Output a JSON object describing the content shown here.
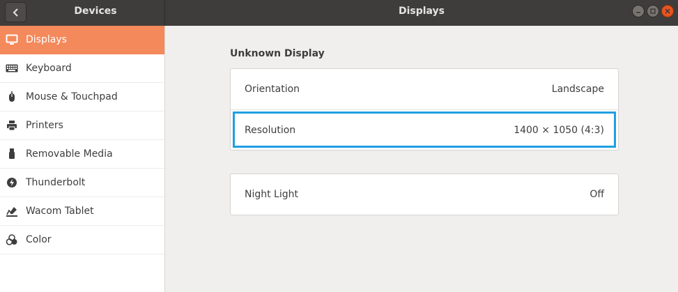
{
  "headerbar": {
    "left_title": "Devices",
    "title": "Displays"
  },
  "sidebar": {
    "items": [
      {
        "label": "Displays",
        "icon": "display-icon",
        "active": true
      },
      {
        "label": "Keyboard",
        "icon": "keyboard-icon"
      },
      {
        "label": "Mouse & Touchpad",
        "icon": "mouse-icon"
      },
      {
        "label": "Printers",
        "icon": "printer-icon"
      },
      {
        "label": "Removable Media",
        "icon": "usb-icon"
      },
      {
        "label": "Thunderbolt",
        "icon": "thunderbolt-icon"
      },
      {
        "label": "Wacom Tablet",
        "icon": "tablet-icon"
      },
      {
        "label": "Color",
        "icon": "color-icon"
      }
    ]
  },
  "main": {
    "section_title": "Unknown Display",
    "display_settings": {
      "orientation_label": "Orientation",
      "orientation_value": "Landscape",
      "resolution_label": "Resolution",
      "resolution_value": "1400 × 1050 (4:3)"
    },
    "night_light": {
      "label": "Night Light",
      "value": "Off"
    }
  },
  "colors": {
    "accent": "#f4895b",
    "headerbar": "#3f3d3b",
    "focus_ring": "#1ea0e1",
    "close_button": "#e95420"
  }
}
